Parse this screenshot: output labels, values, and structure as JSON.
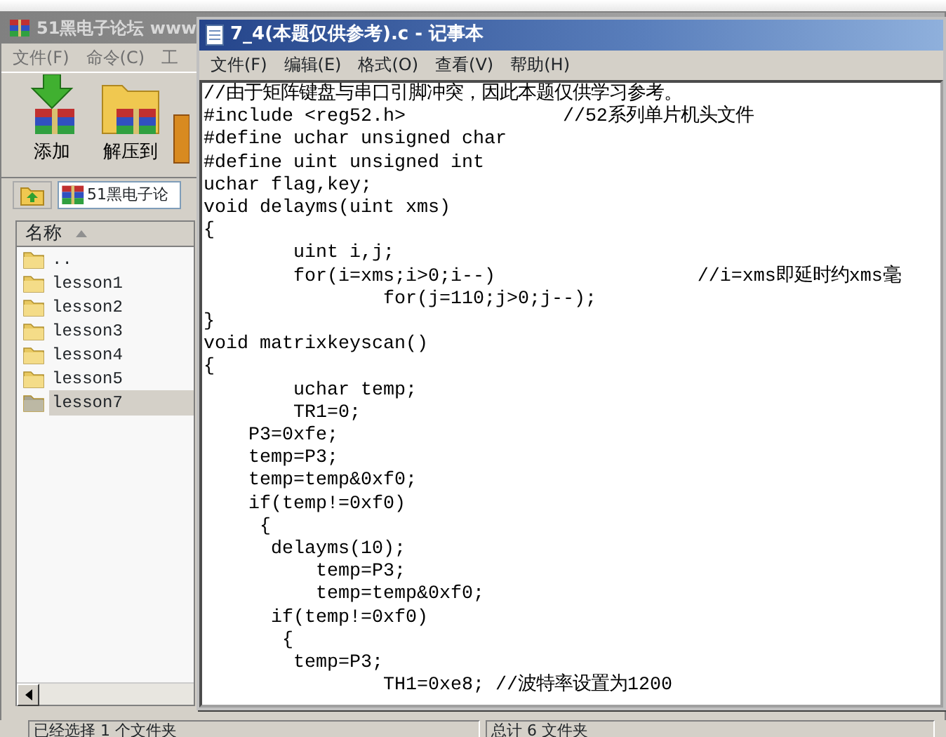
{
  "winrar": {
    "title": "51黑电子论坛 www",
    "active": false,
    "menu": [
      "文件(F)",
      "命令(C)",
      "工"
    ],
    "toolbar": [
      {
        "kind": "add",
        "label": "添加"
      },
      {
        "kind": "extract",
        "label": "解压到"
      },
      {
        "kind": "partial"
      }
    ],
    "address": "51黑电子论",
    "column_header": "名称",
    "sorted": true,
    "files": [
      {
        "name": "..",
        "selected": false
      },
      {
        "name": "lesson1",
        "selected": false
      },
      {
        "name": "lesson2",
        "selected": false
      },
      {
        "name": "lesson3",
        "selected": false
      },
      {
        "name": "lesson4",
        "selected": false
      },
      {
        "name": "lesson5",
        "selected": false
      },
      {
        "name": "lesson7",
        "selected": true
      }
    ],
    "status": [
      "已经选择 1 个文件夹",
      "总计 6 文件夹"
    ]
  },
  "notepad": {
    "title": "7_4(本题仅供参考).c - 记事本",
    "active": true,
    "menu": [
      "文件(F)",
      "编辑(E)",
      "格式(O)",
      "查看(V)",
      "帮助(H)"
    ],
    "lines": [
      "//由于矩阵键盘与串口引脚冲突，因此本题仅供学习参考。",
      "#include <reg52.h>              //52系列单片机头文件",
      "#define uchar unsigned char",
      "#define uint unsigned int",
      "uchar flag,key;",
      "void delayms(uint xms)",
      "{",
      "        uint i,j;",
      "        for(i=xms;i>0;i--)                  //i=xms即延时约xms毫",
      "                for(j=110;j>0;j--);",
      "}",
      "void matrixkeyscan()",
      "{",
      "        uchar temp;",
      "        TR1=0;",
      "    P3=0xfe;",
      "    temp=P3;",
      "    temp=temp&0xf0;",
      "    if(temp!=0xf0)",
      "     {",
      "      delayms(10);",
      "          temp=P3;",
      "          temp=temp&0xf0;",
      "      if(temp!=0xf0)",
      "       {",
      "        temp=P3;",
      "                TH1=0xe8; //波特率设置为1200"
    ]
  }
}
